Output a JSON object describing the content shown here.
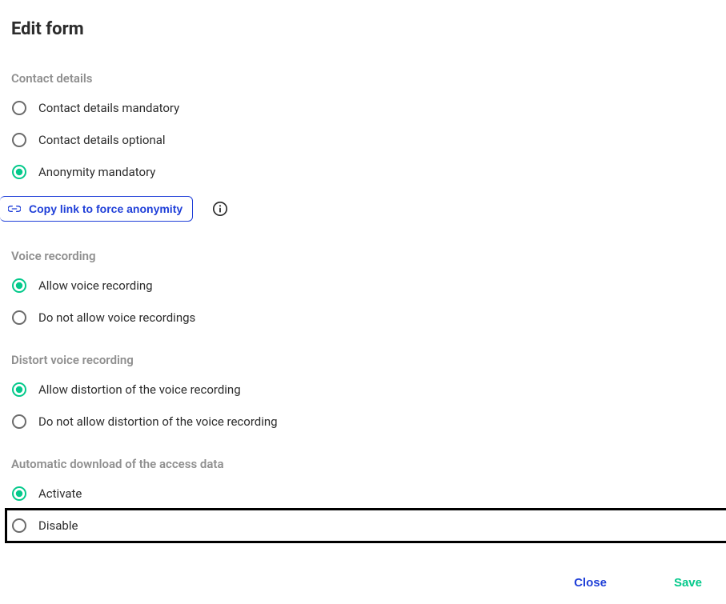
{
  "title": "Edit form",
  "sections": {
    "contact": {
      "label": "Contact details",
      "options": [
        "Contact details mandatory",
        "Contact details optional",
        "Anonymity mandatory"
      ],
      "copyLink": "Copy link to force anonymity"
    },
    "voice": {
      "label": "Voice recording",
      "options": [
        "Allow voice recording",
        "Do not allow voice recordings"
      ]
    },
    "distort": {
      "label": "Distort voice recording",
      "options": [
        "Allow distortion of the voice recording",
        "Do not allow distortion of the voice recording"
      ]
    },
    "autodl": {
      "label": "Automatic download of the access data",
      "options": [
        "Activate",
        "Disable"
      ]
    }
  },
  "buttons": {
    "close": "Close",
    "save": "Save"
  },
  "colors": {
    "accentGreen": "#04c98b",
    "accentBlue": "#1f3fd8",
    "grayRing": "#6b6b6b"
  }
}
